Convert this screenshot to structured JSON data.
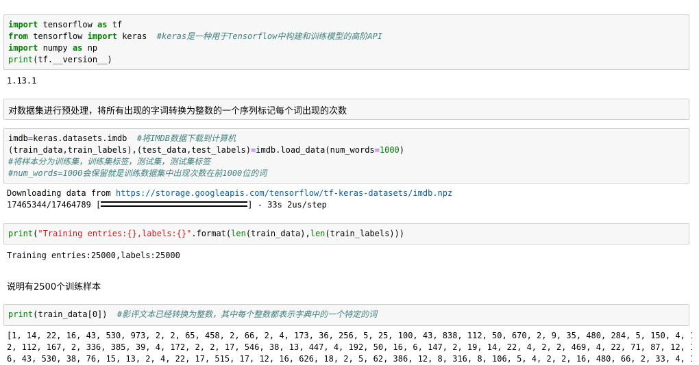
{
  "cell1": {
    "kw_import": "import",
    "mod_tensorflow": " tensorflow ",
    "kw_as": "as",
    "alias_tf": " tf",
    "kw_from": "from",
    "mod_tensorflow2": " tensorflow ",
    "kw_import2": "import",
    "mod_keras": " keras  ",
    "comment_keras": "#keras是一种用于Tensorflow中构建和训练模型的高阶API",
    "kw_import3": "import",
    "mod_numpy": " numpy ",
    "kw_as2": "as",
    "alias_np": " np",
    "fn_print": "print",
    "print_arg": "(tf.__version__)"
  },
  "out1": {
    "version": "1.13.1"
  },
  "md1": {
    "text": "对数据集进行预处理，将所有出现的字词转换为整数的一个序列标记每个词出现的次数"
  },
  "cell2": {
    "l1_a": "imdb",
    "l1_eq": "=",
    "l1_b": "keras.datasets.imdb  ",
    "l1_comment": "#将IMDB数据下载到计算机",
    "l2_a": "(train_data,train_labels),(test_data,test_labels)",
    "l2_eq": "=",
    "l2_b": "imdb.load_data(num_words",
    "l2_eq2": "=",
    "l2_num": "1000",
    "l2_c": ")",
    "l3_comment": "#将样本分为训练集，训练集标签，测试集，测试集标签",
    "l4_comment": "#num_words=1000会保留就是训练数据集中出现次数在前1000位的词"
  },
  "out2": {
    "download_prefix": "Downloading data from ",
    "download_url": "https://storage.googleapis.com/tensorflow/tf-keras-datasets/imdb.npz",
    "progress_counts": "17465344/17464789 ",
    "progress_open": "[",
    "progress_close": "]",
    "progress_tail": " - 33s 2us/step",
    "progress_fraction": 1.0
  },
  "cell3": {
    "fn_print": "print",
    "p1": "(",
    "str": "\"Training entries:{},labels:{}\"",
    "p2": ".format(",
    "fn_len": "len",
    "p3": "(train_data),",
    "fn_len2": "len",
    "p4": "(train_labels)))"
  },
  "out3": {
    "text": "Training entries:25000,labels:25000"
  },
  "md2": {
    "text": "说明有2500个训练样本"
  },
  "cell4": {
    "fn_print": "print",
    "arg": "(train_data[0])  ",
    "comment": "#影评文本已经转换为整数，其中每个整数都表示字典中的一个特定的词"
  },
  "out4": {
    "line1": "[1, 14, 22, 16, 43, 530, 973, 2, 2, 65, 458, 2, 66, 2, 4, 173, 36, 256, 5, 25, 100, 43, 838, 112, 50, 670, 2, 9, 35, 480, 284, 5, 150, 4, 17",
    "line2": "2, 112, 167, 2, 336, 385, 39, 4, 172, 2, 2, 17, 546, 38, 13, 447, 4, 192, 50, 16, 6, 147, 2, 19, 14, 22, 4, 2, 2, 469, 4, 22, 71, 87, 12, 1",
    "line3": "6, 43, 530, 38, 76, 15, 13, 2, 4, 22, 17, 515, 17, 12, 16, 626, 18, 2, 5, 62, 386, 12, 8, 316, 8, 106, 5, 4, 2, 2, 16, 480, 66, 2, 33, 4, 13"
  }
}
